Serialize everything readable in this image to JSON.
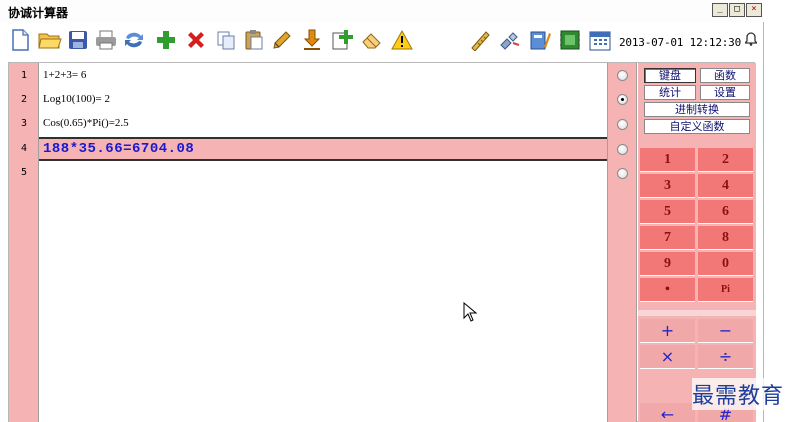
{
  "window": {
    "title": "协诚计算器",
    "minimize": "_",
    "maximize": "□",
    "close": "×"
  },
  "toolbar": {
    "left_icons": [
      "new-file-icon",
      "open-folder-icon",
      "save-icon",
      "print-icon",
      "refresh-icon",
      "add-icon",
      "delete-icon",
      "copy-icon",
      "paste-icon",
      "pencil-icon",
      "download-icon",
      "add-page-icon",
      "eraser-icon",
      "warning-icon"
    ],
    "right_icons": [
      "ruler-icon",
      "satellite-icon",
      "notebook-icon",
      "chip-icon",
      "calendar-icon"
    ],
    "datetime": "2013-07-01 12:12:30",
    "bell": "🔔"
  },
  "editor": {
    "rows": [
      {
        "num": "1",
        "text": "1+2+3= 6"
      },
      {
        "num": "2",
        "text": "Log10(100)= 2"
      },
      {
        "num": "3",
        "text": "Cos(0.65)*Pi()=2.5"
      },
      {
        "num": "4",
        "text": "188*35.66=6704.08"
      },
      {
        "num": "5",
        "text": ""
      }
    ],
    "active_row": 4,
    "selected_radio": 2
  },
  "panel": {
    "tabs": {
      "keyboard": "键盘",
      "functions": "函数",
      "statistics": "统计",
      "settings": "设置",
      "base_convert": "进制转换",
      "custom_function": "自定义函数"
    },
    "keys": [
      "1",
      "2",
      "3",
      "4",
      "5",
      "6",
      "7",
      "8",
      "9",
      "0",
      "•",
      "Pi"
    ],
    "operators": [
      "+",
      "−",
      "×",
      "÷",
      "←",
      "#"
    ]
  },
  "watermark": "最需教育",
  "colors": {
    "row_pink": "#f5b3b3",
    "key_red": "#f27777",
    "expression_blue": "#1a1ad0"
  }
}
